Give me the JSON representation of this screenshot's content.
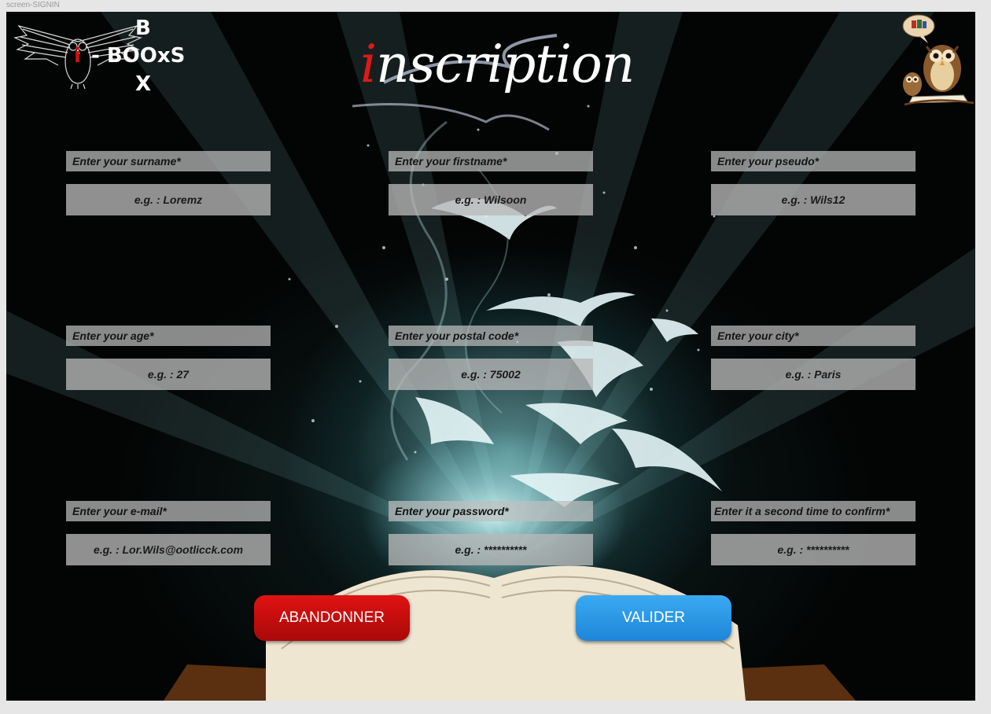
{
  "screen_label": "screen-SIGNIN",
  "logo": {
    "letter_top": "B",
    "letter_i": "i",
    "main": "- BOOxS",
    "letter_bottom": "X"
  },
  "title": {
    "first_letter": "i",
    "rest": "nscription"
  },
  "fields": [
    {
      "label": "Enter your surname*",
      "placeholder": "e.g. : Loremz"
    },
    {
      "label": "Enter your firstname*",
      "placeholder": "e.g. : Wilsoon"
    },
    {
      "label": "Enter your pseudo*",
      "placeholder": "e.g. : Wils12"
    },
    {
      "label": "Enter your age*",
      "placeholder": "e.g. : 27"
    },
    {
      "label": "Enter your postal code*",
      "placeholder": "e.g. : 75002"
    },
    {
      "label": "Enter your city*",
      "placeholder": "e.g. : Paris"
    },
    {
      "label": "Enter your e-mail*",
      "placeholder": "e.g. : Lor.Wils@ootlicck.com"
    },
    {
      "label": "Enter your password*",
      "placeholder": "e.g. : **********"
    },
    {
      "label": "Enter it a second time to confirm*",
      "placeholder": "e.g. : **********"
    }
  ],
  "buttons": {
    "cancel": "ABANDONNER",
    "submit": "VALIDER"
  },
  "colors": {
    "cancel": "#d00f0f",
    "submit": "#2b9cec",
    "accent": "#e01818"
  },
  "icons": {
    "logo": "owl-logo-icon",
    "mascot": "owl-reading-icon"
  }
}
